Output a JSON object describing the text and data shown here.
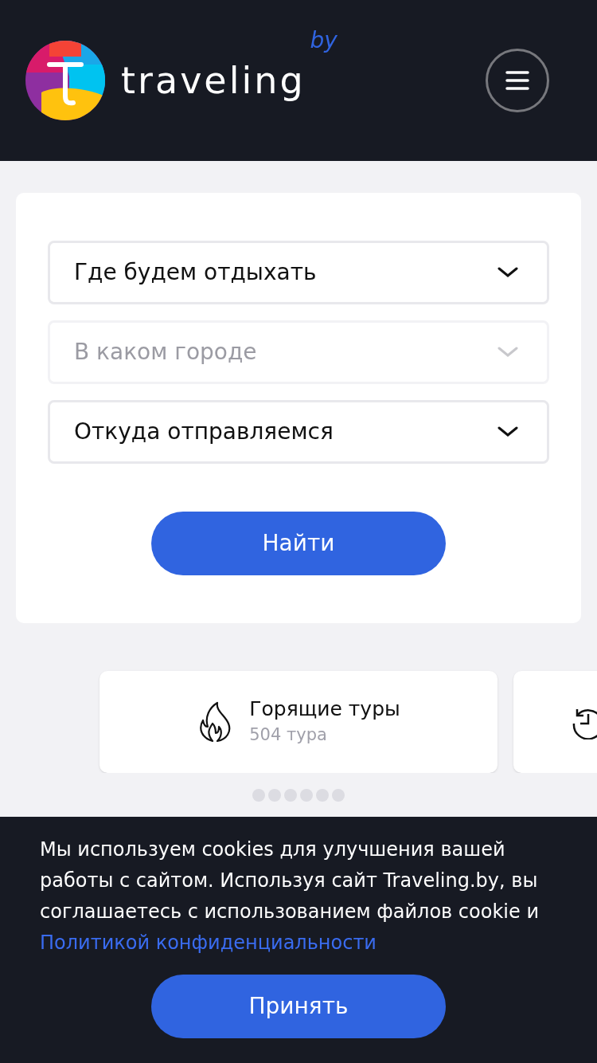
{
  "header": {
    "logo_text": "traveling",
    "logo_suffix": "by"
  },
  "search_form": {
    "fields": [
      {
        "placeholder": "Где будем отдыхать",
        "disabled": false
      },
      {
        "placeholder": "В каком городе",
        "disabled": true
      },
      {
        "placeholder": "Откуда отправляемся",
        "disabled": false
      }
    ],
    "submit": "Найти"
  },
  "carousel": {
    "cards": [
      {
        "kind": "hot",
        "title": "Горящие туры",
        "subtitle": "504 тура"
      },
      {
        "kind": "history"
      }
    ],
    "dots": [
      {
        "selected": false
      },
      {
        "selected": false
      },
      {
        "selected": false
      },
      {
        "selected": false
      },
      {
        "selected": false
      },
      {
        "selected": false
      }
    ]
  },
  "cookie_banner": {
    "text": "Мы используем cookies для улучшения вашей работы с сайтом. Используя сайт Traveling.by, вы соглашаетесь с использованием файлов cookie и",
    "link": "Политикой конфиденциальности",
    "accept": "Принять"
  }
}
